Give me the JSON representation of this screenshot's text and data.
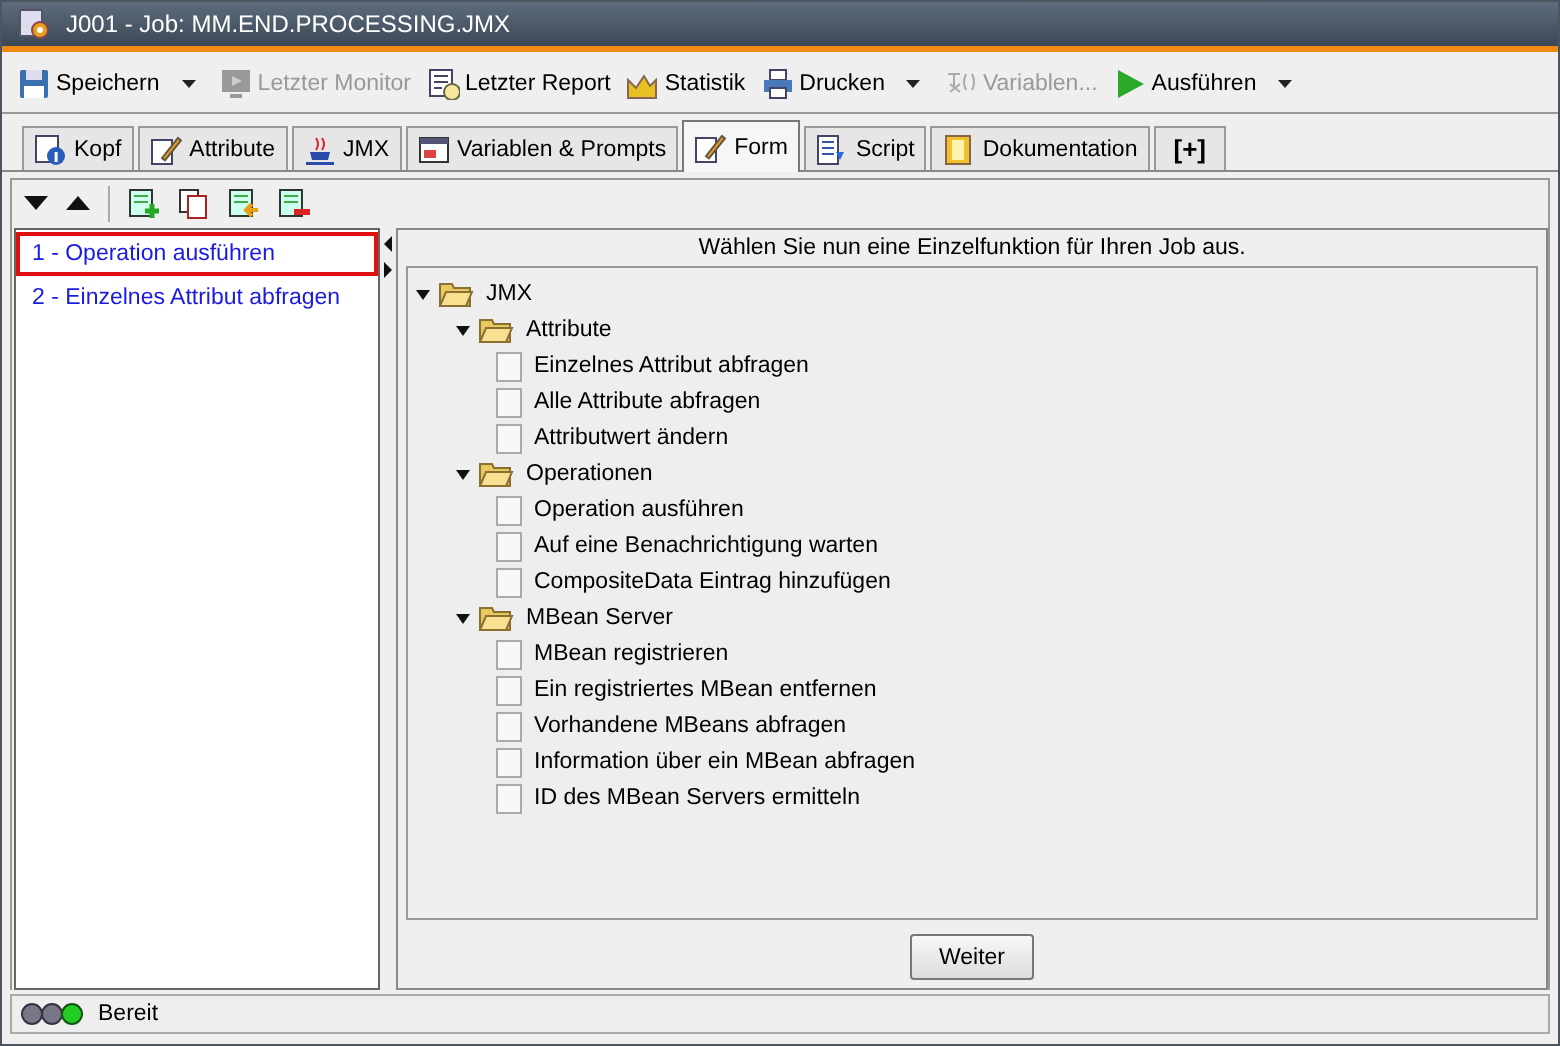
{
  "window": {
    "title": "J001 - Job: MM.END.PROCESSING.JMX"
  },
  "toolbar": [
    {
      "label": "Speichern",
      "disabled": false,
      "dropdown": true
    },
    {
      "label": "Letzter Monitor",
      "disabled": true,
      "dropdown": false
    },
    {
      "label": "Letzter Report",
      "disabled": false,
      "dropdown": false
    },
    {
      "label": "Statistik",
      "disabled": false,
      "dropdown": false
    },
    {
      "label": "Drucken",
      "disabled": false,
      "dropdown": true
    },
    {
      "label": "Variablen...",
      "disabled": true,
      "dropdown": false
    },
    {
      "label": "Ausführen",
      "disabled": false,
      "dropdown": true
    }
  ],
  "tabs": [
    {
      "label": "Kopf",
      "selected": false
    },
    {
      "label": "Attribute",
      "selected": false
    },
    {
      "label": "JMX",
      "selected": false
    },
    {
      "label": "Variablen & Prompts",
      "selected": false
    },
    {
      "label": "Form",
      "selected": true
    },
    {
      "label": "Script",
      "selected": false
    },
    {
      "label": "Dokumentation",
      "selected": false
    },
    {
      "label": "[+]",
      "selected": false
    }
  ],
  "steps": [
    {
      "label": "1 - Operation ausführen",
      "selected": true
    },
    {
      "label": "2 - Einzelnes Attribut abfragen",
      "selected": false
    }
  ],
  "panel": {
    "heading": "Wählen Sie nun eine Einzelfunktion für Ihren Job aus.",
    "tree": [
      {
        "label": "JMX",
        "expanded": true,
        "children": [
          {
            "label": "Attribute",
            "expanded": true,
            "children": [
              {
                "label": "Einzelnes Attribut abfragen"
              },
              {
                "label": "Alle Attribute abfragen"
              },
              {
                "label": "Attributwert ändern"
              }
            ]
          },
          {
            "label": "Operationen",
            "expanded": true,
            "children": [
              {
                "label": "Operation ausführen"
              },
              {
                "label": "Auf eine Benachrichtigung warten"
              },
              {
                "label": "CompositeData Eintrag hinzufügen"
              }
            ]
          },
          {
            "label": "MBean Server",
            "expanded": true,
            "children": [
              {
                "label": "MBean registrieren"
              },
              {
                "label": "Ein registriertes MBean entfernen"
              },
              {
                "label": "Vorhandene MBeans abfragen"
              },
              {
                "label": "Information über ein MBean abfragen"
              },
              {
                "label": "ID des MBean Servers ermitteln"
              }
            ]
          }
        ]
      }
    ],
    "button": "Weiter"
  },
  "status_bar": {
    "text": "Bereit"
  }
}
